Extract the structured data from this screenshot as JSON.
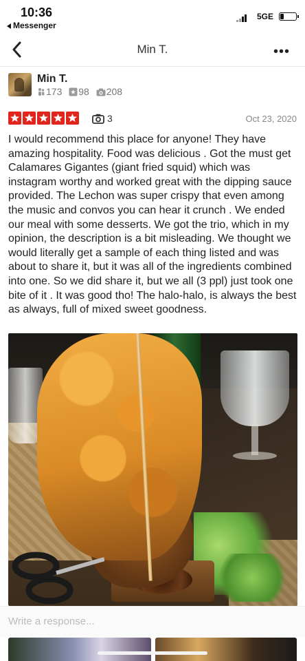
{
  "status_bar": {
    "time": "10:36",
    "back_app": "Messenger",
    "network": "5GE"
  },
  "nav": {
    "title": "Min T.",
    "more_label": "•••"
  },
  "user": {
    "name": "Min T.",
    "friends": "173",
    "reviews": "98",
    "photos": "208"
  },
  "review": {
    "rating": 5,
    "photo_count": "3",
    "date": "Oct 23, 2020",
    "text": "I would recommend this place for anyone! They have amazing hospitality. Food was delicious . Got the must get Calamares Gigantes (giant fried squid) which was instagram worthy and worked great with the dipping sauce provided. The Lechon was super crispy that even among the music and convos you can hear it crunch . We ended our meal with some desserts. We got the trio, which in my opinion, the description is a bit misleading. We thought we would literally get a sample of each thing listed and was about to share it, but it was all of the ingredients combined into one. So we did share it, but we all (3 ppl) just took one bite of it . It was good tho! The halo-halo, is always the best as always, full of mixed sweet goodness."
  },
  "response": {
    "placeholder": "Write a response..."
  },
  "colors": {
    "star_red": "#e0261c",
    "text": "#222222",
    "muted": "#888888"
  }
}
